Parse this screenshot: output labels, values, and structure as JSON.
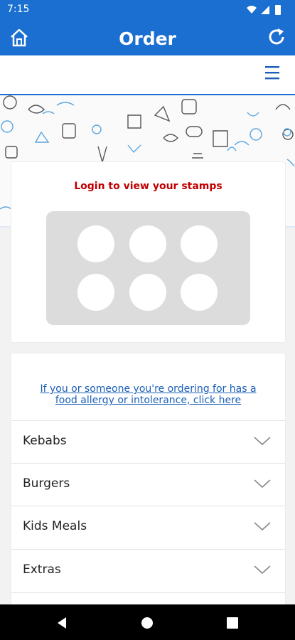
{
  "status": {
    "time": "7:15"
  },
  "appbar": {
    "title": "Order"
  },
  "stamps": {
    "login_text": "Login to view your stamps"
  },
  "allergy": {
    "line1": "If you or someone you're ordering for has a",
    "line2": "food allergy or intolerance, click here"
  },
  "categories": [
    {
      "label": "Kebabs"
    },
    {
      "label": "Burgers"
    },
    {
      "label": "Kids Meals"
    },
    {
      "label": "Extras"
    }
  ],
  "colors": {
    "primary": "#1b6fd1",
    "login_red": "#c00000",
    "link_blue": "#1b5fb8"
  }
}
